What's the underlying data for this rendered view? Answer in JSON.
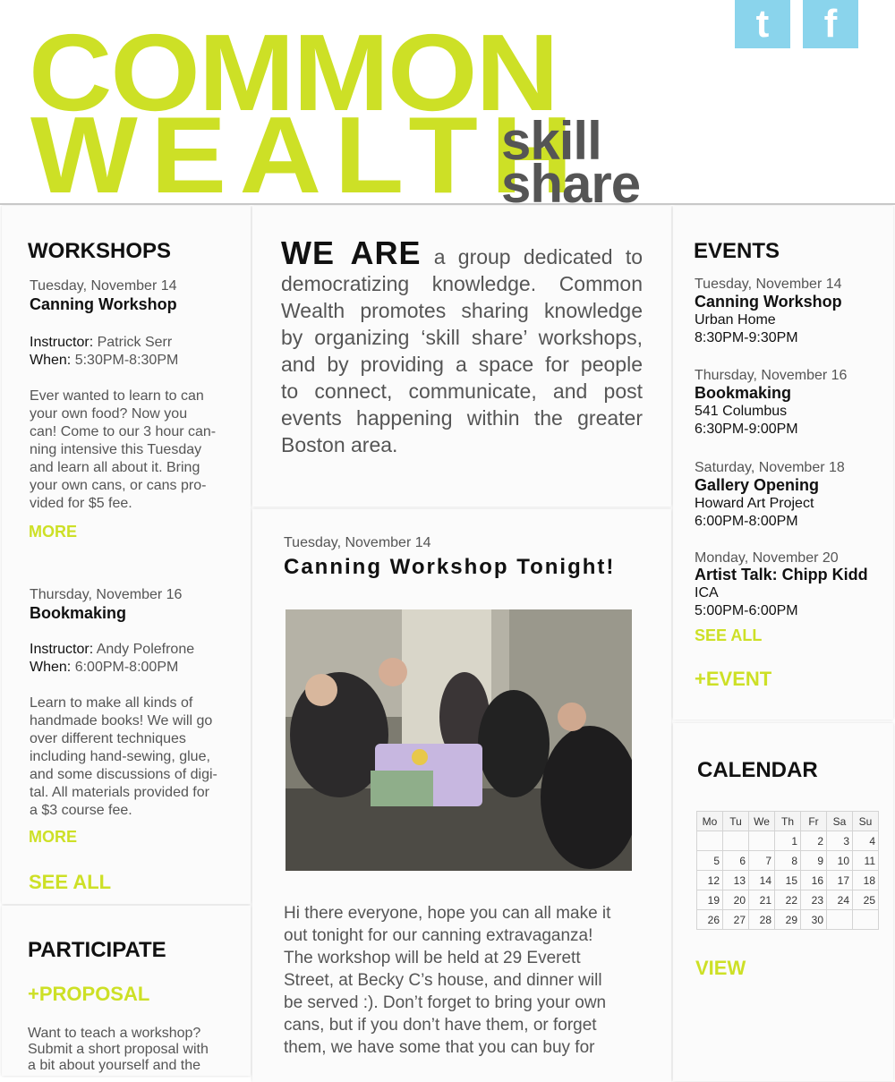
{
  "header": {
    "logo_line1": "COMMON",
    "logo_line2": "WEALTH",
    "logo_skill": "skill",
    "logo_share": "share",
    "social": [
      {
        "label": "t",
        "icon": "tumblr-icon"
      },
      {
        "label": "f",
        "icon": "facebook-icon"
      }
    ]
  },
  "colors": {
    "accent": "#cde026",
    "text": "#111111",
    "muted": "#555555",
    "social": "#8ad4ec"
  },
  "workshops": {
    "title": "WORKSHOPS",
    "items": [
      {
        "date": "Tuesday, November 14",
        "title": "Canning Workshop",
        "instructor_label": "Instructor:",
        "instructor": "Patrick Serr",
        "when_label": "When:",
        "when": "5:30PM-8:30PM",
        "lines": [
          "Ever wanted to learn to can",
          "your own food?  Now you",
          "can! Come to our 3 hour can-",
          "ning intensive this Tuesday",
          "and learn all about it. Bring",
          "your own cans, or cans pro-",
          "vided for $5 fee."
        ],
        "more": "MORE"
      },
      {
        "date": "Thursday, November 16",
        "title": "Bookmaking",
        "instructor_label": "Instructor:",
        "instructor": "Andy Polefrone",
        "when_label": "When:",
        "when": "6:00PM-8:00PM",
        "lines": [
          "Learn to make all kinds of",
          "handmade books! We will go",
          "over different techniques",
          "including hand-sewing, glue,",
          "and some discussions of digi-",
          "tal. All materials provided for",
          "a $3 course fee."
        ],
        "more": "MORE"
      }
    ],
    "see_all": "SEE ALL"
  },
  "participate": {
    "title": "PARTICIPATE",
    "proposal": "+PROPOSAL",
    "lines": [
      "Want to teach a workshop?",
      "Submit a short proposal with",
      "a bit about yourself and the"
    ]
  },
  "about": {
    "lead": "WE ARE",
    "lines": [
      "a group dedicated to",
      "democratizing knowledge. Common",
      "Wealth promotes sharing knowledge",
      "by organizing ‘skill share’ workshops,",
      "and by providing a space for people",
      "to connect, communicate, and post",
      "events happening within the greater",
      "Boston area."
    ]
  },
  "post": {
    "date": "Tuesday, November 14",
    "title": "Canning Workshop Tonight!",
    "lines": [
      "Hi there everyone, hope you can all make it",
      "out tonight for our canning extravaganza!",
      "The workshop will be held at 29 Everett",
      "Street, at Becky C’s house, and dinner will",
      "be served :). Don’t forget to bring your own",
      "cans, but if you don’t have them, or forget",
      "them, we have some that you can buy for"
    ]
  },
  "events": {
    "title": "EVENTS",
    "items": [
      {
        "date": "Tuesday, November 14",
        "title": "Canning Workshop",
        "place": "Urban Home",
        "time": "8:30PM-9:30PM"
      },
      {
        "date": "Thursday, November 16",
        "title": "Bookmaking",
        "place": "541 Columbus",
        "time": "6:30PM-9:00PM"
      },
      {
        "date": "Saturday, November 18",
        "title": "Gallery Opening",
        "place": "Howard Art Project",
        "time": "6:00PM-8:00PM"
      },
      {
        "date": "Monday, November 20",
        "title": "Artist Talk: Chipp Kidd",
        "place": "ICA",
        "time": "5:00PM-6:00PM"
      }
    ],
    "see_all": "SEE ALL",
    "add_event": "+EVENT"
  },
  "calendar": {
    "title": "CALENDAR",
    "days": [
      "Mo",
      "Tu",
      "We",
      "Th",
      "Fr",
      "Sa",
      "Su"
    ],
    "weeks": [
      [
        "",
        "",
        "",
        "1",
        "2",
        "3",
        "4"
      ],
      [
        "5",
        "6",
        "7",
        "8",
        "9",
        "10",
        "11"
      ],
      [
        "12",
        "13",
        "14",
        "15",
        "16",
        "17",
        "18"
      ],
      [
        "19",
        "20",
        "21",
        "22",
        "23",
        "24",
        "25"
      ],
      [
        "26",
        "27",
        "28",
        "29",
        "30",
        "",
        ""
      ]
    ],
    "view": "VIEW"
  }
}
